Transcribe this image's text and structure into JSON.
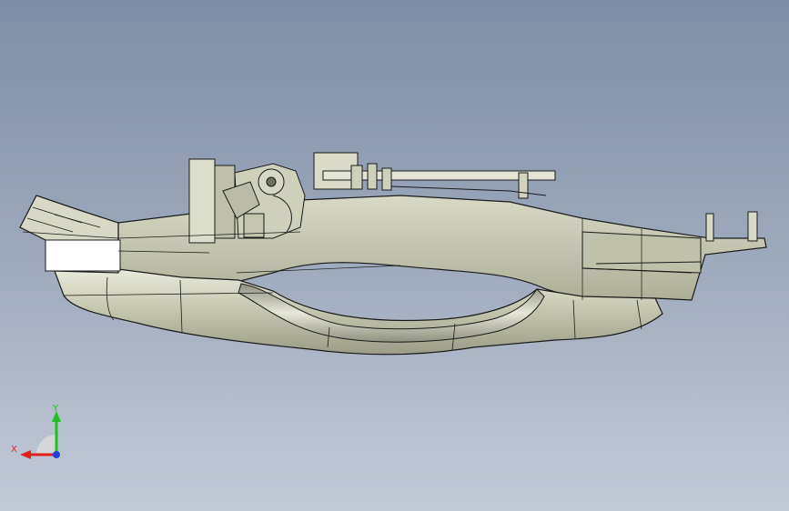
{
  "viewport": {
    "background_top": "#7f8ea6",
    "background_bottom": "#c3cad8"
  },
  "model": {
    "base_color": "#c9cab3",
    "shade_color": "#a9aa94",
    "highlight_color": "#f1f2ea",
    "edge_color": "#1a1a1a"
  },
  "triad": {
    "x_label": "X",
    "y_label": "Y",
    "x_color": "#e02020",
    "y_color": "#20c020",
    "z_color": "#2040e0"
  }
}
